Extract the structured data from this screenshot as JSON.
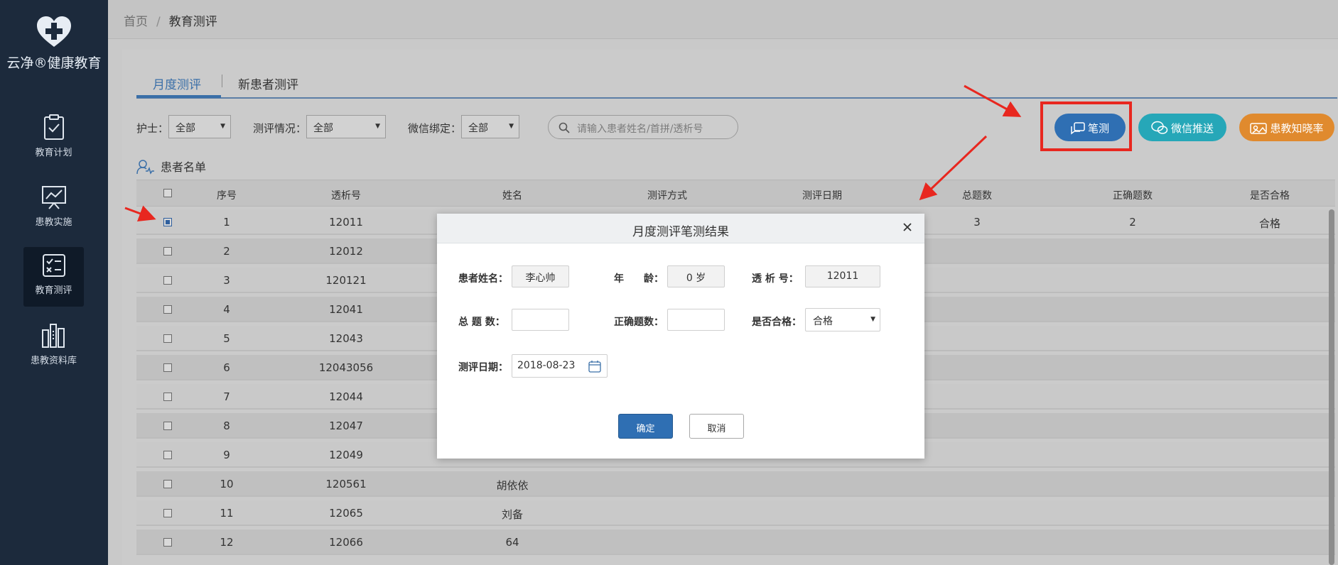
{
  "app": {
    "name": "云净®健康教育"
  },
  "sidebar": {
    "items": [
      {
        "label": "教育计划",
        "icon": "clipboard-check-icon",
        "active": false
      },
      {
        "label": "患教实施",
        "icon": "presentation-board-icon",
        "active": false
      },
      {
        "label": "教育测评",
        "icon": "checklist-icon",
        "active": true
      },
      {
        "label": "患教资料库",
        "icon": "books-icon",
        "active": false
      }
    ]
  },
  "breadcrumb": {
    "home": "首页",
    "separator": "/",
    "current": "教育测评"
  },
  "tabs": [
    {
      "label": "月度测评",
      "active": true
    },
    {
      "label": "新患者测评",
      "active": false
    }
  ],
  "filters": {
    "nurse": {
      "label": "护士：",
      "value": "全部"
    },
    "status": {
      "label": "测评情况：",
      "value": "全部"
    },
    "wechat": {
      "label": "微信绑定：",
      "value": "全部"
    },
    "search_placeholder": "请输入患者姓名/首拼/透析号"
  },
  "actions": {
    "written_test": "笔测",
    "wechat_push": "微信推送",
    "awareness_rate": "患教知晓率"
  },
  "list_title": "患者名单",
  "table": {
    "headers": [
      "序号",
      "透析号",
      "姓名",
      "测评方式",
      "测评日期",
      "总题数",
      "正确题数",
      "是否合格"
    ],
    "rows": [
      {
        "no": "1",
        "dialysis_no": "12011",
        "name": "",
        "total": "3",
        "correct": "2",
        "pass": "合格",
        "checked": true
      },
      {
        "no": "2",
        "dialysis_no": "12012",
        "name": ""
      },
      {
        "no": "3",
        "dialysis_no": "120121",
        "name": ""
      },
      {
        "no": "4",
        "dialysis_no": "12041",
        "name": ""
      },
      {
        "no": "5",
        "dialysis_no": "12043",
        "name": ""
      },
      {
        "no": "6",
        "dialysis_no": "12043056",
        "name": ""
      },
      {
        "no": "7",
        "dialysis_no": "12044",
        "name": ""
      },
      {
        "no": "8",
        "dialysis_no": "12047",
        "name": ""
      },
      {
        "no": "9",
        "dialysis_no": "12049",
        "name": ""
      },
      {
        "no": "10",
        "dialysis_no": "120561",
        "name": "胡依依"
      },
      {
        "no": "11",
        "dialysis_no": "12065",
        "name": "刘备"
      },
      {
        "no": "12",
        "dialysis_no": "12066",
        "name": "64"
      }
    ]
  },
  "modal": {
    "title": "月度测评笔测结果",
    "patient_name_label": "患者姓名：",
    "patient_name": "李心帅",
    "age_label": "年　　龄：",
    "age": "0 岁",
    "dialysis_label": "透 析 号：",
    "dialysis_no": "12011",
    "total_label": "总 题 数：",
    "total": "",
    "correct_label": "正确题数：",
    "correct": "",
    "pass_label": "是否合格：",
    "pass": "合格",
    "date_label": "测评日期：",
    "date": "2018-08-23",
    "ok": "确定",
    "cancel": "取消"
  },
  "colors": {
    "sidebar_bg": "#1c2a3c",
    "accent_blue": "#3a6fa8",
    "btn_written": "#2f6fb3",
    "btn_wechat": "#26a7b8",
    "btn_rate": "#e08a2e",
    "annotation_red": "#e8271f"
  }
}
